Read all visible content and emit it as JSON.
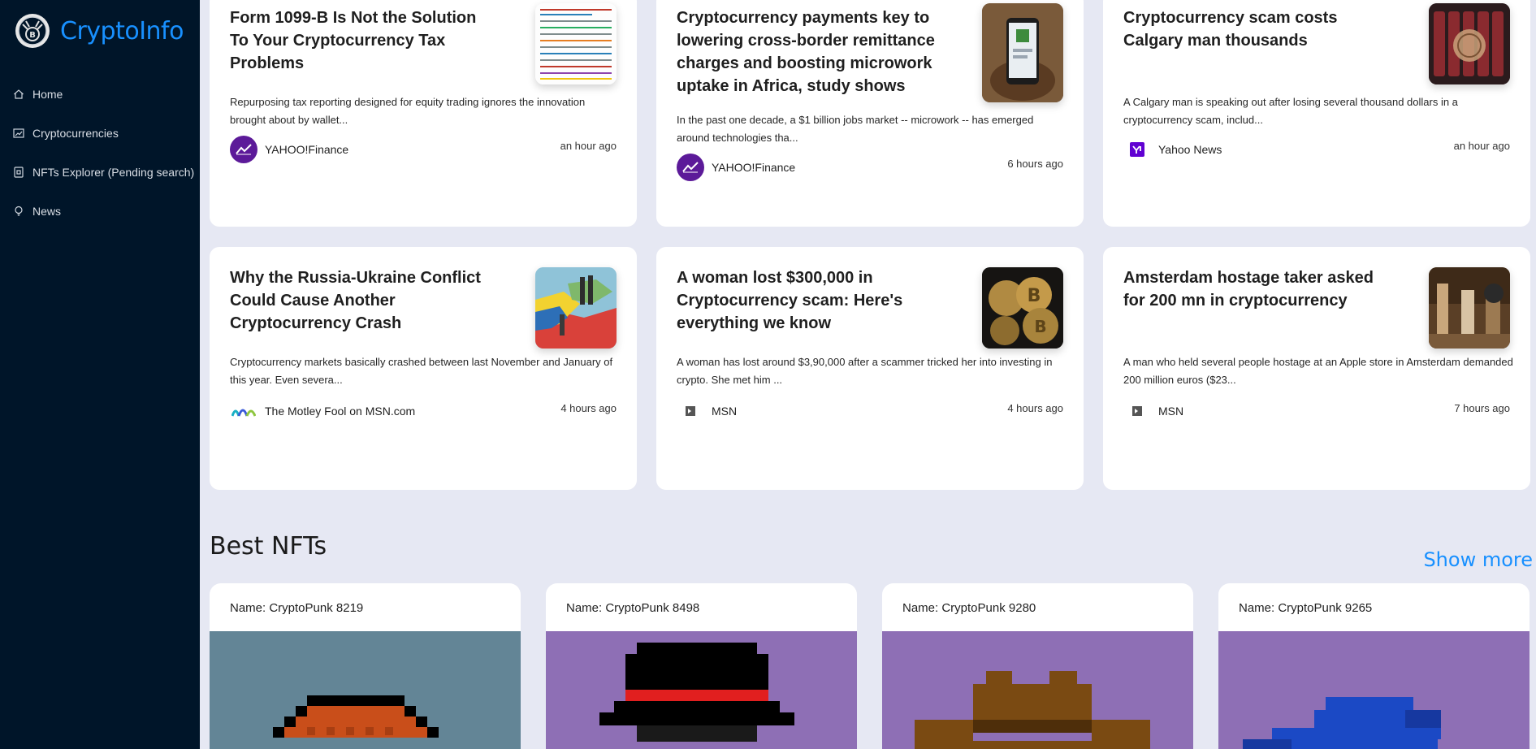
{
  "app": {
    "name": "CryptoInfo",
    "logo_icon": "crypto-logo-icon"
  },
  "nav": [
    {
      "label": "Home",
      "icon": "home-icon"
    },
    {
      "label": "Cryptocurrencies",
      "icon": "chart-icon"
    },
    {
      "label": "NFTs Explorer (Pending search)",
      "icon": "nft-icon"
    },
    {
      "label": "News",
      "icon": "bulb-icon"
    }
  ],
  "news": [
    {
      "title": "Form 1099-B Is Not the Solution To Your Cryptocurrency Tax Problems",
      "description": "Repurposing tax reporting designed for equity trading ignores the innovation brought about by wallet...",
      "provider": "YAHOO!Finance",
      "time": "an hour ago"
    },
    {
      "title": "Cryptocurrency payments key to lowering cross-border remittance charges and boosting microwork uptake in Africa, study shows",
      "description": "In the past one decade, a $1 billion jobs market -- microwork -- has emerged around technologies tha...",
      "provider": "YAHOO!Finance",
      "time": "6 hours ago"
    },
    {
      "title": "Cryptocurrency scam costs Calgary man thousands",
      "description": "A Calgary man is speaking out after losing several thousand dollars in a cryptocurrency scam, includ...",
      "provider": "Yahoo News",
      "time": "an hour ago"
    },
    {
      "title": "Why the Russia-Ukraine Conflict Could Cause Another Cryptocurrency Crash",
      "description": "Cryptocurrency markets basically crashed between last November and January of this year. Even severa...",
      "provider": "The Motley Fool on MSN.com",
      "time": "4 hours ago"
    },
    {
      "title": "A woman lost $300,000 in Cryptocurrency scam: Here's everything we know",
      "description": "A woman has lost around $3,90,000 after a scammer tricked her into investing in crypto. She met him ...",
      "provider": "MSN",
      "time": "4 hours ago"
    },
    {
      "title": "Amsterdam hostage taker asked for 200 mn in cryptocurrency",
      "description": "A man who held several people hostage at an Apple store in Amsterdam demanded 200 million euros ($23...",
      "provider": "MSN",
      "time": "7 hours ago"
    }
  ],
  "nfts": {
    "section_title": "Best NFTs",
    "show_more": "Show more",
    "items": [
      {
        "name": "Name: CryptoPunk 8219"
      },
      {
        "name": "Name: CryptoPunk 8498"
      },
      {
        "name": "Name: CryptoPunk 9280"
      },
      {
        "name": "Name: CryptoPunk 9265"
      }
    ]
  },
  "colors": {
    "sidebar_bg": "#001529",
    "accent": "#1890ff",
    "page_bg": "#e6e8f3",
    "yahoo_purple": "#5c1a99"
  }
}
